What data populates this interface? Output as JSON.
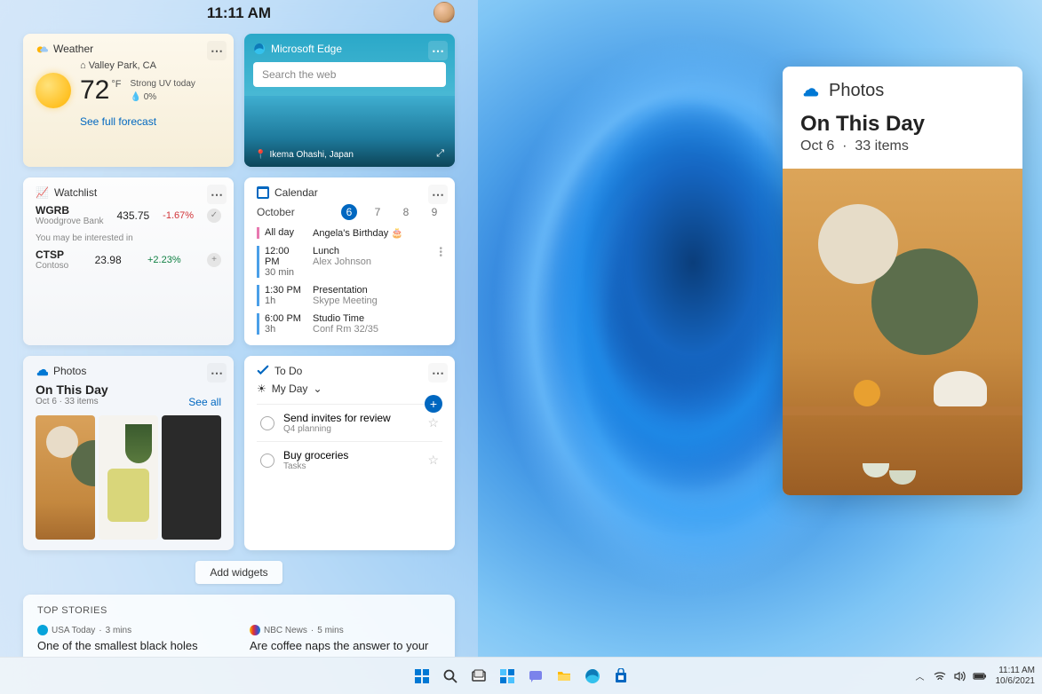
{
  "panel": {
    "time": "11:11 AM"
  },
  "weather": {
    "title": "Weather",
    "location": "Valley Park, CA",
    "temp": "72",
    "unit": "°F",
    "condition": "Strong UV today",
    "precip": "0%",
    "forecast_link": "See full forecast"
  },
  "edge": {
    "title": "Microsoft Edge",
    "search_placeholder": "Search the web",
    "caption": "Ikema Ohashi, Japan"
  },
  "watchlist": {
    "title": "Watchlist",
    "rows": [
      {
        "sym": "WGRB",
        "name": "Woodgrove Bank",
        "price": "435.75",
        "chg": "-1.67%",
        "dir": "neg"
      },
      {
        "sym": "CTSP",
        "name": "Contoso",
        "price": "23.98",
        "chg": "+2.23%",
        "dir": "pos"
      }
    ],
    "hint": "You may be interested in"
  },
  "calendar": {
    "title": "Calendar",
    "month": "October",
    "dates": [
      "6",
      "7",
      "8",
      "9"
    ],
    "selected": "6",
    "events": [
      {
        "time": "All day",
        "dur": "",
        "title": "Angela's Birthday 🎂",
        "sub": "",
        "color": "pink"
      },
      {
        "time": "12:00 PM",
        "dur": "30 min",
        "title": "Lunch",
        "sub": "Alex Johnson",
        "color": "blue",
        "dots": true
      },
      {
        "time": "1:30 PM",
        "dur": "1h",
        "title": "Presentation",
        "sub": "Skype Meeting",
        "color": "blue"
      },
      {
        "time": "6:00 PM",
        "dur": "3h",
        "title": "Studio Time",
        "sub": "Conf Rm 32/35",
        "color": "blue"
      }
    ]
  },
  "photos_small": {
    "title": "Photos",
    "heading": "On This Day",
    "date": "Oct 6",
    "count": "33 items",
    "see_all": "See all"
  },
  "todo": {
    "title": "To Do",
    "list_name": "My Day",
    "items": [
      {
        "title": "Send invites for review",
        "sub": "Q4 planning"
      },
      {
        "title": "Buy groceries",
        "sub": "Tasks"
      }
    ]
  },
  "add_widgets": "Add widgets",
  "stories": {
    "heading": "TOP STORIES",
    "items": [
      {
        "source": "USA Today",
        "age": "3 mins",
        "title": "One of the smallest black holes"
      },
      {
        "source": "NBC News",
        "age": "5 mins",
        "title": "Are coffee naps the answer to your"
      }
    ]
  },
  "photos_flyout": {
    "app": "Photos",
    "heading": "On This Day",
    "date": "Oct 6",
    "count": "33 items"
  },
  "taskbar": {
    "time": "11:11 AM",
    "date": "10/6/2021"
  }
}
